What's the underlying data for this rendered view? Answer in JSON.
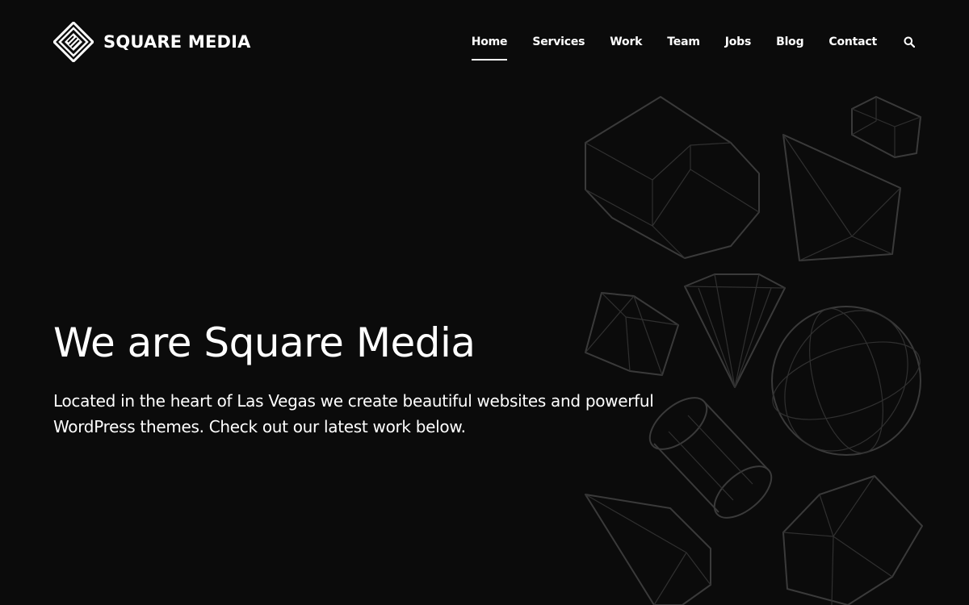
{
  "brand": {
    "name": "SQUARE MEDIA",
    "logo_icon": "diamond-logo-icon"
  },
  "nav": {
    "items": [
      {
        "label": "Home",
        "active": true
      },
      {
        "label": "Services",
        "active": false
      },
      {
        "label": "Work",
        "active": false
      },
      {
        "label": "Team",
        "active": false
      },
      {
        "label": "Jobs",
        "active": false
      },
      {
        "label": "Blog",
        "active": false
      },
      {
        "label": "Contact",
        "active": false
      }
    ],
    "search_icon": "search-icon"
  },
  "hero": {
    "title": "We are Square Media",
    "description": "Located in the heart of Las Vegas we create beautiful websites and powerful WordPress themes. Check out our latest work below."
  },
  "colors": {
    "background": "#0b0b0b",
    "text": "#ffffff",
    "shape_stroke": "#3a3a3a"
  }
}
